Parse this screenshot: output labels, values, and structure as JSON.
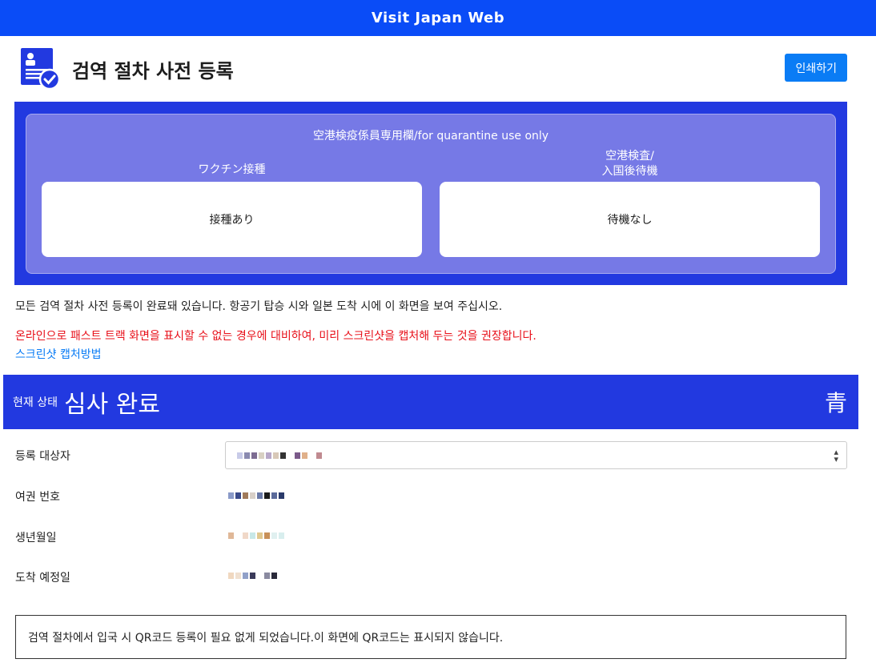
{
  "topbar": {
    "brand": "Visit Japan Web"
  },
  "header": {
    "title": "검역 절차 사전 등록",
    "print_label": "인쇄하기"
  },
  "quarantine": {
    "title": "空港検疫係員専用欄/for quarantine use only",
    "vaccine_label": "ワクチン接種",
    "vaccine_value": "接種あり",
    "airport_label_1": "空港検査/",
    "airport_label_2": "入国後待機",
    "airport_value": "待機なし"
  },
  "notices": {
    "completed": "모든 검역 절차 사전 등록이 완료돼 있습니다. 항공기 탑승 시와 일본 도착 시에 이 화면을 보여 주십시오.",
    "warning": "온라인으로 패스트 트랙 화면을 표시할 수 없는 경우에 대비하여, 미리 스크린샷을 캡처해 두는 것을 권장합니다.",
    "screenshot_link": "스크린샷 캡처방법"
  },
  "status": {
    "label": "현재 상태",
    "value": "심사 완료",
    "color_label": "青",
    "color_hex": "#2239e0"
  },
  "fields": {
    "registrant_label": "등록 대상자",
    "passport_label": "여권 번호",
    "birthdate_label": "생년월일",
    "arrival_label": "도착 예정일"
  },
  "qr_note": "검역 절차에서 입국 시 QR코드 등록이 필요 없게 되었습니다.이 화면에 QR코드는 표시되지 않습니다."
}
